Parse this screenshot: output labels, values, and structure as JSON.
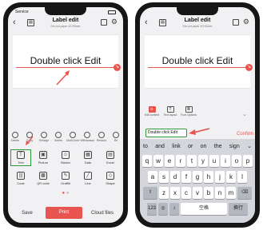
{
  "left_phone": {
    "status": {
      "left": "Service",
      "right": ""
    },
    "header": {
      "title": "Label edit",
      "subtitle": "Die-cut paper 40*30mm"
    },
    "canvas_text": "Double click Edit",
    "toolbar_small": [
      {
        "label": "Delete",
        "icon": "trash-icon"
      },
      {
        "label": "Copy",
        "icon": "copy-icon"
      },
      {
        "label": "Enlarge",
        "icon": "zoom-in-icon"
      },
      {
        "label": "Shrink",
        "icon": "zoom-out-icon"
      },
      {
        "label": "Multi.Joint",
        "icon": "select-icon"
      },
      {
        "label": "Withdrawal",
        "icon": "undo-icon"
      },
      {
        "label": "Restore",
        "icon": "redo-icon"
      },
      {
        "label": "Re",
        "icon": "rotate-icon"
      }
    ],
    "grid_row1": [
      {
        "label": "Text",
        "icon": "text-icon",
        "glyph": "T"
      },
      {
        "label": "Picture",
        "icon": "picture-icon",
        "glyph": "▣"
      },
      {
        "label": "Sticker",
        "icon": "sticker-icon",
        "glyph": "☺"
      },
      {
        "label": "Date",
        "icon": "date-icon",
        "glyph": "▦"
      },
      {
        "label": "Excel",
        "icon": "excel-icon",
        "glyph": "▤"
      }
    ],
    "grid_row2": [
      {
        "label": "Code",
        "icon": "barcode-icon",
        "glyph": "|||"
      },
      {
        "label": "QR code",
        "icon": "qr-code-icon",
        "glyph": "▩"
      },
      {
        "label": "Graffiti",
        "icon": "graffiti-icon",
        "glyph": "✎"
      },
      {
        "label": "Line",
        "icon": "line-icon",
        "glyph": "╱"
      },
      {
        "label": "Shape",
        "icon": "shape-icon",
        "glyph": "◇"
      }
    ],
    "bottom": {
      "save": "Save",
      "print": "Print",
      "cloud": "Cloud files"
    }
  },
  "right_phone": {
    "header": {
      "title": "Label edit",
      "subtitle": "Die-cut paper 40*30mm"
    },
    "canvas_text": "Double click Edit",
    "edit_tabs": [
      {
        "label": "Edit content",
        "icon": "edit-content-icon",
        "glyph": "≡"
      },
      {
        "label": "Text layout",
        "icon": "text-layout-icon",
        "glyph": "T"
      },
      {
        "label": "Font Options",
        "icon": "font-options-icon",
        "glyph": "≣"
      }
    ],
    "input_value": "Double click Edit",
    "confirm": "Confirm",
    "keyboard": {
      "suggestions": [
        "to",
        "and",
        "link",
        "or",
        "on",
        "the",
        "sign"
      ],
      "row1": [
        "q",
        "w",
        "e",
        "r",
        "t",
        "y",
        "u",
        "i",
        "o",
        "p"
      ],
      "row2": [
        "a",
        "s",
        "d",
        "f",
        "g",
        "h",
        "j",
        "k",
        "l"
      ],
      "row3": [
        "z",
        "x",
        "c",
        "v",
        "b",
        "n",
        "m"
      ],
      "num_key": "123",
      "space": "空格",
      "return": "换行"
    }
  },
  "colors": {
    "accent": "#e8544f",
    "highlight": "#2e9b3a"
  }
}
